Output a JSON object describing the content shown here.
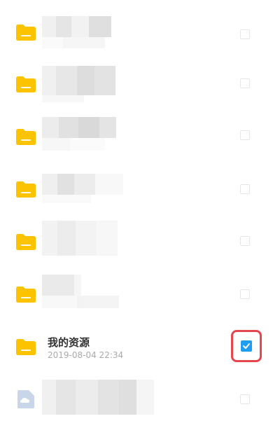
{
  "items": [
    {
      "name": "",
      "time": "",
      "selected": false,
      "blurred": true
    },
    {
      "name": "",
      "time": "",
      "selected": false,
      "blurred": true
    },
    {
      "name": "",
      "time": "",
      "selected": false,
      "blurred": true
    },
    {
      "name": "",
      "time": "",
      "selected": false,
      "blurred": true
    },
    {
      "name": "",
      "time": "",
      "selected": false,
      "blurred": true
    },
    {
      "name": "",
      "time": "",
      "selected": false,
      "blurred": true
    },
    {
      "name": "我的资源",
      "time": "2019-08-04 22:34",
      "selected": true,
      "blurred": false
    },
    {
      "name": "",
      "time": "",
      "selected": false,
      "blurred": true
    }
  ],
  "colors": {
    "folder": "#fbc300",
    "check_selected": "#1f9df2",
    "highlight": "#e5474e"
  },
  "icons": {
    "folder": "folder-icon",
    "cloud": "cloud-icon",
    "check": "checkbox-icon"
  }
}
